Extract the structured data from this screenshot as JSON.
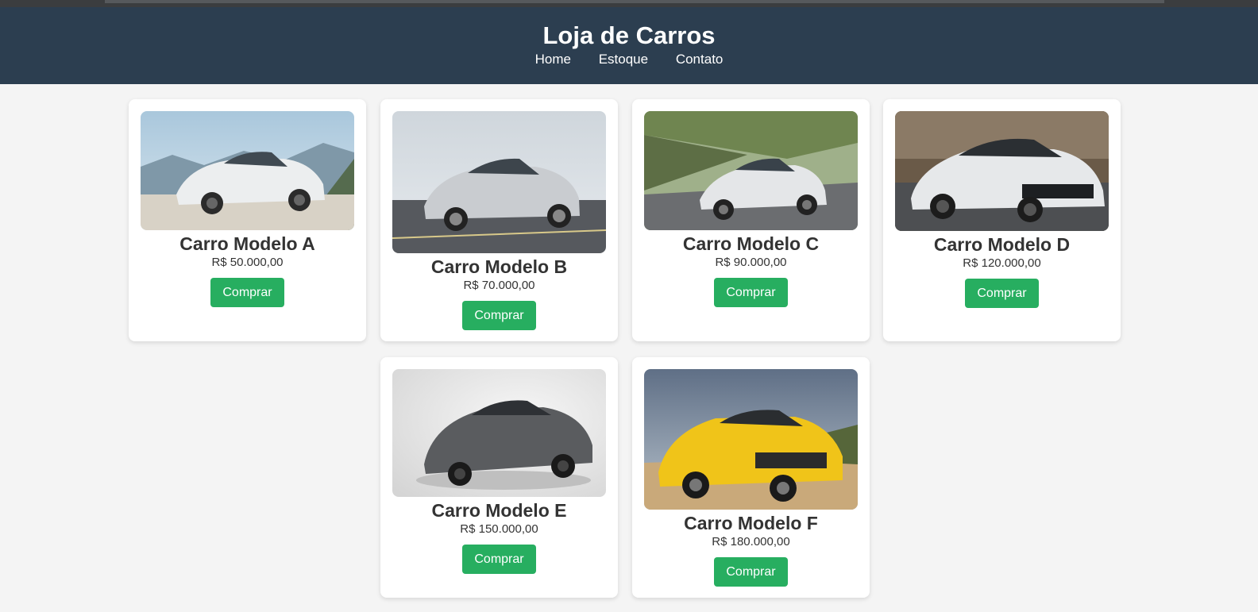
{
  "header": {
    "title": "Loja de Carros",
    "nav": [
      "Home",
      "Estoque",
      "Contato"
    ]
  },
  "cars": [
    {
      "name": "Carro Modelo A",
      "price": "R$ 50.000,00",
      "button": "Comprar"
    },
    {
      "name": "Carro Modelo B",
      "price": "R$ 70.000,00",
      "button": "Comprar"
    },
    {
      "name": "Carro Modelo C",
      "price": "R$ 90.000,00",
      "button": "Comprar"
    },
    {
      "name": "Carro Modelo D",
      "price": "R$ 120.000,00",
      "button": "Comprar"
    },
    {
      "name": "Carro Modelo E",
      "price": "R$ 150.000,00",
      "button": "Comprar"
    },
    {
      "name": "Carro Modelo F",
      "price": "R$ 180.000,00",
      "button": "Comprar"
    }
  ],
  "colors": {
    "header_bg": "#2c3e50",
    "button_bg": "#27ae60",
    "page_bg": "#f4f4f4"
  }
}
